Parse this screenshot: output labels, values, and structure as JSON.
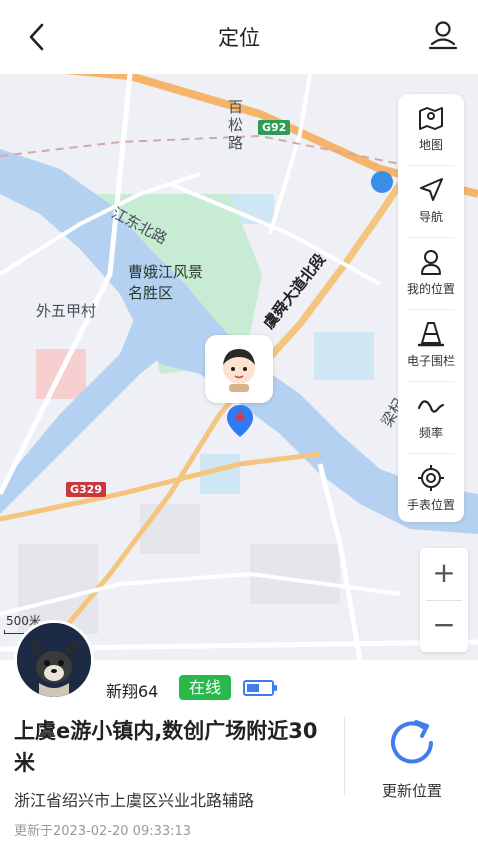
{
  "header": {
    "back_icon": "chevron-left-icon",
    "title": "定位",
    "right_icon": "person-pin-icon"
  },
  "map": {
    "labels": {
      "baisong_road": "百松路",
      "highway_g92": "G92",
      "jiangdong_north_road": "江东北路",
      "scenic_area": "曹娥江风景名胜区",
      "waiwu_jia_village": "外五甲村",
      "yushun_avenue": "虞舜大道北段",
      "liangzhu_road": "梁杞",
      "highway_g329": "G329"
    },
    "scale_text": "500米",
    "colors": {
      "water": "#b5d1f1",
      "park": "#c8ebd4",
      "arterial": "#f5b46a",
      "road": "#ffffff",
      "pin": "#2f7bf6",
      "pin_accent": "#e23b3b"
    }
  },
  "toolbar": {
    "items": [
      {
        "label": "地图",
        "icon": "map-icon"
      },
      {
        "label": "导航",
        "icon": "navigation-arrow-icon"
      },
      {
        "label": "我的位置",
        "icon": "person-icon"
      },
      {
        "label": "电子围栏",
        "icon": "traffic-cone-icon"
      },
      {
        "label": "频率",
        "icon": "wave-icon"
      },
      {
        "label": "手表位置",
        "icon": "target-icon"
      }
    ]
  },
  "zoom": {
    "in": "+",
    "out": "−"
  },
  "device": {
    "name": "新翔64",
    "status": "在线",
    "status_color": "#28b84c",
    "battery_icon": "battery-icon",
    "battery_level": 0.5
  },
  "location": {
    "title": "上虞e游小镇内,数创广场附近30米",
    "address": "浙江省绍兴市上虞区兴业北路辅路",
    "updated": "更新于2023-02-20 09:33:13"
  },
  "refresh": {
    "label": "更新位置",
    "icon": "refresh-icon",
    "color": "#3f7cf0"
  }
}
